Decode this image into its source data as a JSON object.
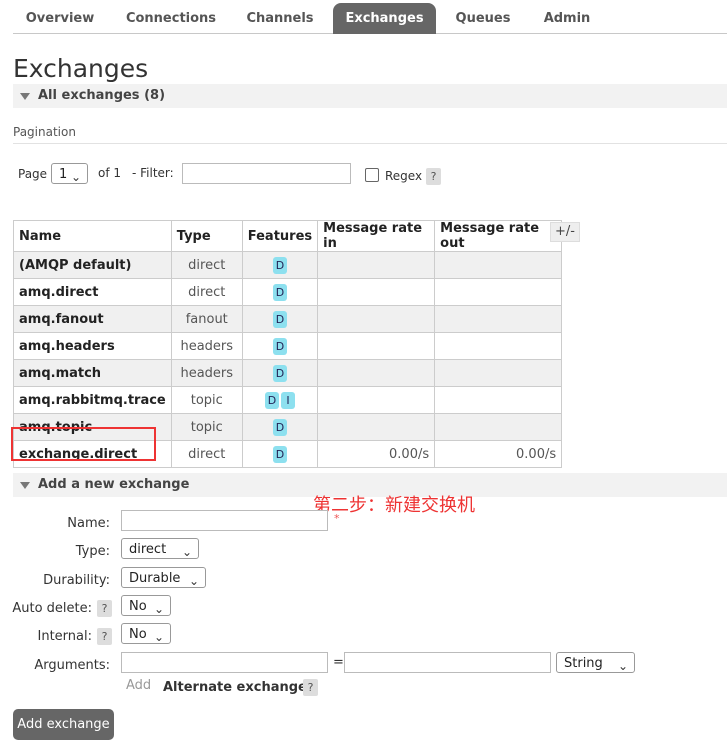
{
  "nav": {
    "tabs": [
      {
        "label": "Overview"
      },
      {
        "label": "Connections"
      },
      {
        "label": "Channels"
      },
      {
        "label": "Exchanges",
        "active": true
      },
      {
        "label": "Queues"
      },
      {
        "label": "Admin"
      }
    ]
  },
  "page_title": "Exchanges",
  "all_exchanges": {
    "title": "All exchanges (8)"
  },
  "pagination": {
    "label": "Pagination",
    "page_label": "Page",
    "page_value": "1",
    "of_label": "of 1",
    "filter_label": "- Filter:",
    "filter_value": "",
    "regex_label": "Regex",
    "regex_checked": false,
    "help": "?"
  },
  "table": {
    "columns": [
      "Name",
      "Type",
      "Features",
      "Message rate in",
      "Message rate out"
    ],
    "toggle_columns_label": "+/-",
    "rows": [
      {
        "name": "(AMQP default)",
        "type": "direct",
        "features": [
          "D"
        ],
        "rate_in": "",
        "rate_out": ""
      },
      {
        "name": "amq.direct",
        "type": "direct",
        "features": [
          "D"
        ],
        "rate_in": "",
        "rate_out": ""
      },
      {
        "name": "amq.fanout",
        "type": "fanout",
        "features": [
          "D"
        ],
        "rate_in": "",
        "rate_out": ""
      },
      {
        "name": "amq.headers",
        "type": "headers",
        "features": [
          "D"
        ],
        "rate_in": "",
        "rate_out": ""
      },
      {
        "name": "amq.match",
        "type": "headers",
        "features": [
          "D"
        ],
        "rate_in": "",
        "rate_out": ""
      },
      {
        "name": "amq.rabbitmq.trace",
        "type": "topic",
        "features": [
          "D",
          "I"
        ],
        "rate_in": "",
        "rate_out": ""
      },
      {
        "name": "amq.topic",
        "type": "topic",
        "features": [
          "D"
        ],
        "rate_in": "",
        "rate_out": ""
      },
      {
        "name": "exchange.direct",
        "type": "direct",
        "features": [
          "D"
        ],
        "rate_in": "0.00/s",
        "rate_out": "0.00/s"
      }
    ]
  },
  "add_exchange": {
    "title": "Add a new exchange",
    "annotation": "第二步：新建交换机",
    "name_label": "Name:",
    "name_value": "",
    "required_mark": "*",
    "type_label": "Type:",
    "type_value": "direct",
    "durability_label": "Durability:",
    "durability_value": "Durable",
    "auto_delete_label": "Auto delete:",
    "auto_delete_value": "No",
    "internal_label": "Internal:",
    "internal_value": "No",
    "arguments_label": "Arguments:",
    "arg_key_value": "",
    "equals": "=",
    "arg_value": "",
    "arg_type_value": "String",
    "add_link_label": "Add",
    "alternate_exchange_label": "Alternate exchange",
    "help": "?",
    "submit_label": "Add exchange"
  },
  "colors": {
    "active_tab": "#666666",
    "badge": "#8de0ef",
    "highlight": "#ee3333",
    "annotation": "#ee3333"
  },
  "icons": {
    "collapse": "triangle-down-icon",
    "select": "chevron-down-icon"
  }
}
